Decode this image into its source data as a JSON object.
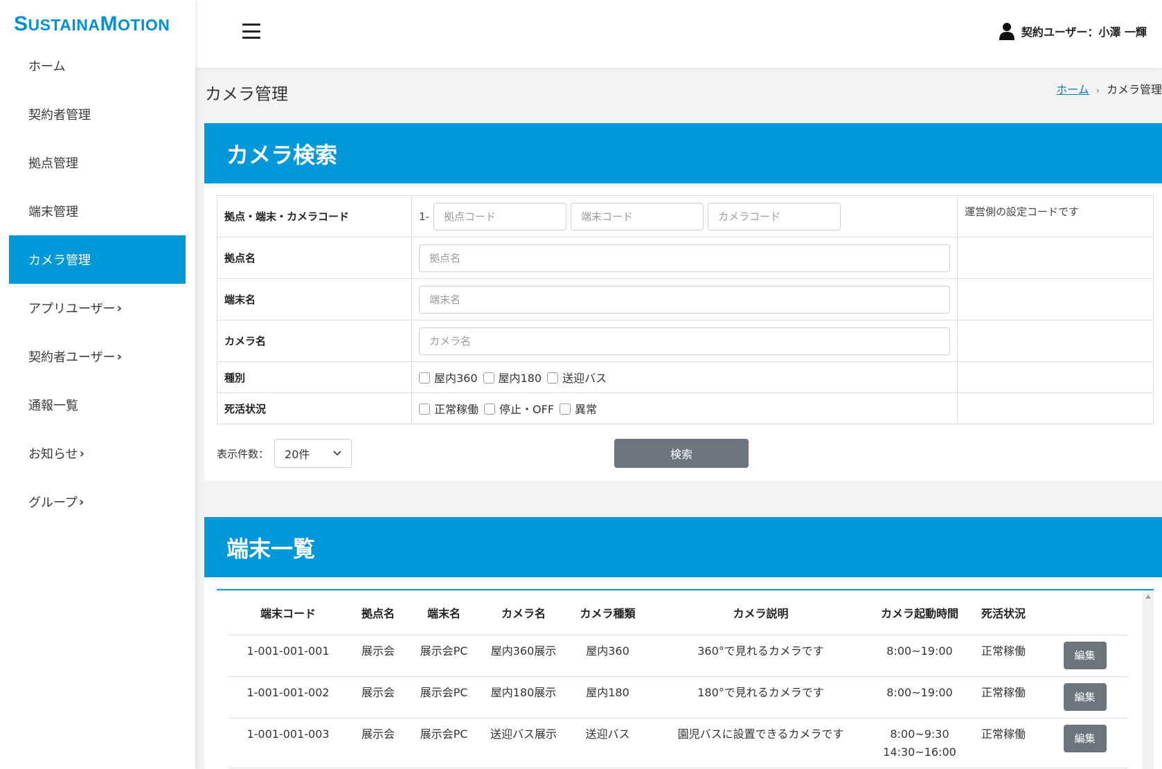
{
  "brand": {
    "logo_s": "S",
    "logo_mid": "USTAINA",
    "logo_m": "M",
    "logo_end": "OTION"
  },
  "sidebar": {
    "items": [
      {
        "label": "ホーム",
        "chevron": ""
      },
      {
        "label": "契約者管理",
        "chevron": ""
      },
      {
        "label": "拠点管理",
        "chevron": ""
      },
      {
        "label": "端末管理",
        "chevron": ""
      },
      {
        "label": "カメラ管理",
        "chevron": "",
        "active": true
      },
      {
        "label": "アプリユーザー",
        "chevron": "›"
      },
      {
        "label": "契約者ユーザー",
        "chevron": "›"
      },
      {
        "label": "通報一覧",
        "chevron": ""
      },
      {
        "label": "お知らせ",
        "chevron": "›"
      },
      {
        "label": "グループ",
        "chevron": "›"
      }
    ]
  },
  "header": {
    "user_label": "契約ユーザー：小澤 一輝",
    "user_icon": "person-icon",
    "menu_icon": "hamburger-icon"
  },
  "page": {
    "title": "カメラ管理"
  },
  "breadcrumb": {
    "home": "ホーム",
    "separator": "›",
    "current": "カメラ管理"
  },
  "search": {
    "heading": "カメラ検索",
    "code_label": "拠点・端末・カメラコード",
    "code_prefix": "1-",
    "base_code_placeholder": "拠点コード",
    "terminal_code_placeholder": "端末コード",
    "camera_code_placeholder": "カメラコード",
    "code_note": "運営側の設定コードです",
    "base_name_label": "拠点名",
    "base_name_placeholder": "拠点名",
    "terminal_name_label": "端末名",
    "terminal_name_placeholder": "端末名",
    "camera_name_label": "カメラ名",
    "camera_name_placeholder": "カメラ名",
    "type_label": "種別",
    "type_options": [
      "屋内360",
      "屋内180",
      "送迎バス"
    ],
    "status_label": "死活状況",
    "status_options": [
      "正常稼働",
      "停止・OFF",
      "異常"
    ],
    "per_page_label": "表示件数：",
    "per_page_value": "20件",
    "search_button": "検索"
  },
  "list": {
    "heading": "端末一覧",
    "columns": [
      "端末コード",
      "拠点名",
      "端末名",
      "カメラ名",
      "カメラ種類",
      "カメラ説明",
      "カメラ起動時間",
      "死活状況",
      ""
    ],
    "rows": [
      {
        "code": "1-001-001-001",
        "base": "展示会",
        "terminal": "展示会PC",
        "camera": "屋内360展示",
        "type": "屋内360",
        "desc": "360°で見れるカメラです",
        "time1": "8:00~19:00",
        "time2": "",
        "status": "正常稼働",
        "edit": "編集"
      },
      {
        "code": "1-001-001-002",
        "base": "展示会",
        "terminal": "展示会PC",
        "camera": "屋内180展示",
        "type": "屋内180",
        "desc": "180°で見れるカメラです",
        "time1": "8:00~19:00",
        "time2": "",
        "status": "正常稼働",
        "edit": "編集"
      },
      {
        "code": "1-001-001-003",
        "base": "展示会",
        "terminal": "展示会PC",
        "camera": "送迎バス展示",
        "type": "送迎バス",
        "desc": "園児バスに設置できるカメラです",
        "time1": "8:00~9:30",
        "time2": "14:30~16:00",
        "status": "正常稼働",
        "edit": "編集"
      }
    ]
  },
  "colors": {
    "accent": "#0098d8",
    "logo": "#0090d3",
    "button_gray": "#6c757d",
    "link": "#0a7fbd"
  }
}
